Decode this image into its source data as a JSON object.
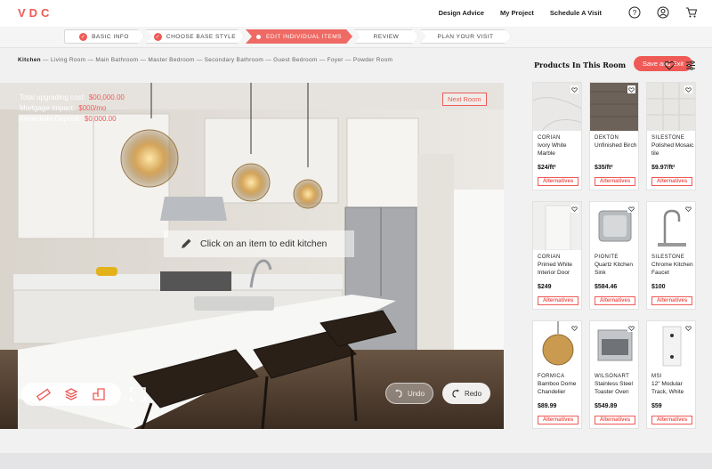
{
  "logo": "VDC",
  "nav": {
    "links": [
      "Design Advice",
      "My Project",
      "Schedule A Visit"
    ]
  },
  "icons": {
    "help": "help-icon",
    "account": "account-icon",
    "cart": "cart-icon"
  },
  "steps": [
    {
      "label": "BASIC INFO",
      "state": "done"
    },
    {
      "label": "CHOOSE BASE STYLE",
      "state": "done"
    },
    {
      "label": "EDIT INDIVIDUAL ITEMS",
      "state": "active"
    },
    {
      "label": "REVIEW",
      "state": "todo"
    },
    {
      "label": "PLAN YOUR VISIT",
      "state": "todo"
    }
  ],
  "save_label": "Save and Exit",
  "rooms": {
    "current": "Kitchen",
    "others": [
      "Living Room",
      "Main Bathroom",
      "Master Bedroom",
      "Secondary Bathroom",
      "Guest Bedroom",
      "Foyer",
      "Powder Room"
    ]
  },
  "stats": [
    {
      "label": "Total upgrading cost:",
      "value": "$00,000.00"
    },
    {
      "label": "Mortgage Impact:",
      "value": "$000/mo"
    },
    {
      "label": "Immediate Deposit:",
      "value": "$0,000.00"
    }
  ],
  "next_room": "Next Room",
  "hint": "Click on an item to edit kitchen",
  "undo_label": "Undo",
  "redo_label": "Redo",
  "panel": {
    "title": "Products In This Room",
    "alt_label": "Alternatives",
    "products": [
      {
        "brand": "CORIAN",
        "name": "Ivory White Marble",
        "price": "$24/ft²",
        "swatch": "marble"
      },
      {
        "brand": "DEKTON",
        "name": "Unfinished Birch",
        "price": "$35/ft²",
        "swatch": "wood"
      },
      {
        "brand": "SILESTONE",
        "name": "Polished Mosaic tile",
        "price": "$9.97/ft²",
        "swatch": "tile"
      },
      {
        "brand": "CORIAN",
        "name": "Primed White Interior Door",
        "price": "$249",
        "swatch": "door"
      },
      {
        "brand": "PIONITE",
        "name": "Quartz Kitchen Sink",
        "price": "$584.46",
        "swatch": "sink"
      },
      {
        "brand": "SILESTONE",
        "name": "Chrome Kitchen Faucet",
        "price": "$100",
        "swatch": "faucet"
      },
      {
        "brand": "FORMICA",
        "name": "Bamboo Dome Chandelier",
        "price": "$89.99",
        "swatch": "lamp"
      },
      {
        "brand": "WILSONART",
        "name": "Stainless Steel Toaster Oven",
        "price": "$549.89",
        "swatch": "oven"
      },
      {
        "brand": "MSI",
        "name": "12\" Modular Track, White",
        "price": "$59",
        "swatch": "track"
      }
    ]
  },
  "colors": {
    "accent": "#ef5a56"
  }
}
